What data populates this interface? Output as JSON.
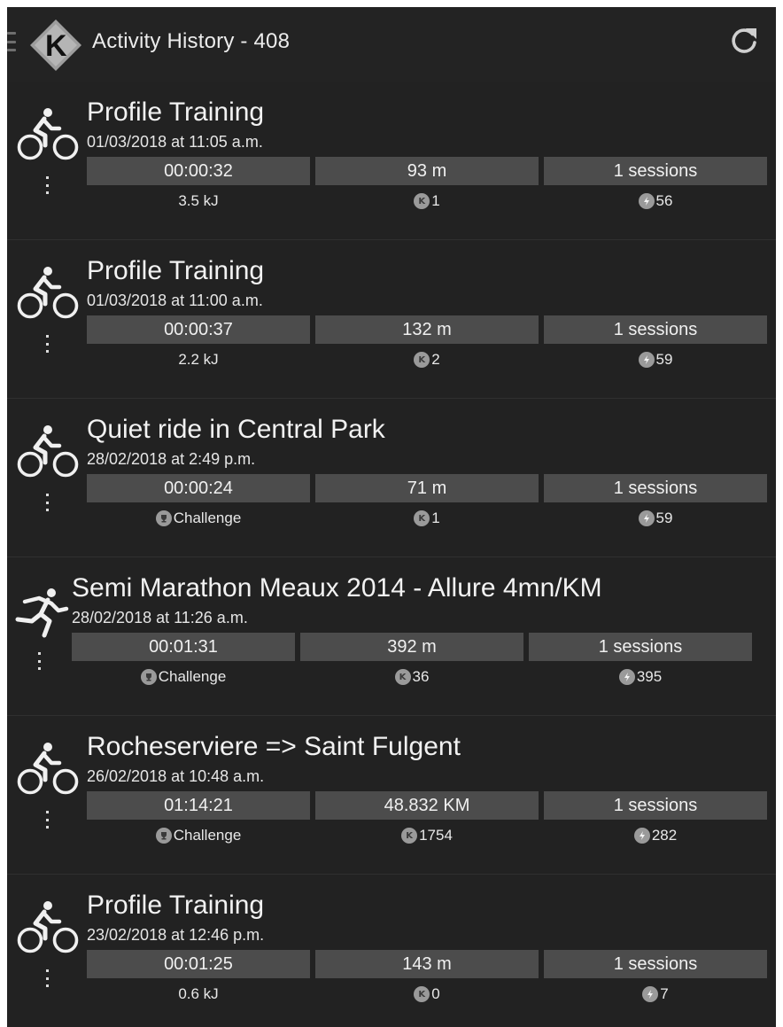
{
  "app": {
    "title": "Activity History - 408",
    "icons": {
      "menu": "hamburger-menu-icon",
      "logo": "kinomap-logo",
      "refresh": "refresh-icon"
    }
  },
  "activities": [
    {
      "type": "bike",
      "icon": "cycling-icon",
      "title": "Profile Training",
      "date": "01/03/2018 at 11:05 a.m.",
      "duration": "00:00:32",
      "distance": "93 m",
      "sessions": "1 sessions",
      "detail": "3.5 kJ",
      "k_points": "1",
      "energy_points": "56"
    },
    {
      "type": "bike",
      "icon": "cycling-icon",
      "title": "Profile Training",
      "date": "01/03/2018 at 11:00 a.m.",
      "duration": "00:00:37",
      "distance": "132 m",
      "sessions": "1 sessions",
      "detail": "2.2 kJ",
      "k_points": "2",
      "energy_points": "59"
    },
    {
      "type": "bike",
      "icon": "cycling-icon",
      "title": "Quiet ride in Central Park",
      "date": "28/02/2018 at 2:49 p.m.",
      "duration": "00:00:24",
      "distance": "71 m",
      "sessions": "1 sessions",
      "detail": "Challenge",
      "detail_icon": "trophy-icon",
      "k_points": "1",
      "energy_points": "59"
    },
    {
      "type": "run",
      "icon": "running-icon",
      "title": "Semi Marathon Meaux 2014 - Allure 4mn/KM",
      "date": "28/02/2018 at 11:26 a.m.",
      "duration": "00:01:31",
      "distance": "392 m",
      "sessions": "1 sessions",
      "detail": "Challenge",
      "detail_icon": "trophy-icon",
      "k_points": "36",
      "energy_points": "395"
    },
    {
      "type": "bike",
      "icon": "cycling-icon",
      "title": "Rocheserviere => Saint Fulgent",
      "date": "26/02/2018 at 10:48 a.m.",
      "duration": "01:14:21",
      "distance": "48.832 KM",
      "sessions": "1 sessions",
      "detail": "Challenge",
      "detail_icon": "trophy-icon",
      "k_points": "1754",
      "energy_points": "282"
    },
    {
      "type": "bike",
      "icon": "cycling-icon",
      "title": "Profile Training",
      "date": "23/02/2018 at 12:46 p.m.",
      "duration": "00:01:25",
      "distance": "143 m",
      "sessions": "1 sessions",
      "detail": "0.6 kJ",
      "k_points": "0",
      "energy_points": "7"
    }
  ],
  "badges": {
    "k_letter": "K"
  },
  "colors": {
    "background": "#222222",
    "stat_bar": "#4c4c4c",
    "text": "#f0f0f0",
    "badge": "#9a9a9a"
  }
}
